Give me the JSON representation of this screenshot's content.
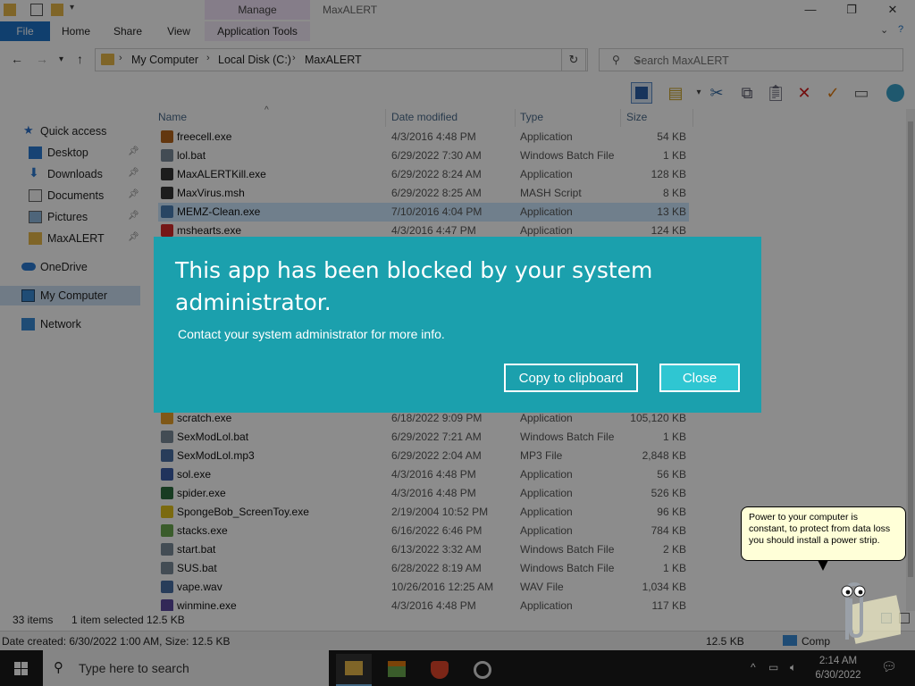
{
  "window": {
    "title": "MaxALERT",
    "contextual_tab": "Manage",
    "controls": {
      "minimize": "—",
      "maximize": "❐",
      "close": "✕"
    }
  },
  "ribbon": {
    "tabs": [
      "File",
      "Home",
      "Share",
      "View",
      "Application Tools"
    ],
    "expand_icon": "⌄",
    "help_icon": "?"
  },
  "address": {
    "crumbs": [
      "My Computer",
      "Local Disk (C:)",
      "MaxALERT"
    ],
    "search_placeholder": "Search MaxALERT"
  },
  "nav_pane": {
    "items": [
      {
        "label": "Quick access",
        "icon": "star-icon",
        "pinned": false
      },
      {
        "label": "Desktop",
        "icon": "desktop-icon",
        "pinned": true
      },
      {
        "label": "Downloads",
        "icon": "download-icon",
        "pinned": true
      },
      {
        "label": "Documents",
        "icon": "documents-icon",
        "pinned": true
      },
      {
        "label": "Pictures",
        "icon": "pictures-icon",
        "pinned": true
      },
      {
        "label": "MaxALERT",
        "icon": "folder-icon",
        "pinned": true
      },
      {
        "label": "OneDrive",
        "icon": "cloud-icon",
        "pinned": false
      },
      {
        "label": "My Computer",
        "icon": "computer-icon",
        "pinned": false,
        "selected": true
      },
      {
        "label": "Network",
        "icon": "network-icon",
        "pinned": false
      }
    ]
  },
  "columns": [
    "Name",
    "Date modified",
    "Type",
    "Size"
  ],
  "files": [
    {
      "name": "freecell.exe",
      "date": "4/3/2016 4:48 PM",
      "type": "Application",
      "size": "54 KB",
      "color": "#b5651d"
    },
    {
      "name": "lol.bat",
      "date": "6/29/2022 7:30 AM",
      "type": "Windows Batch File",
      "size": "1 KB",
      "color": "#7a8a99"
    },
    {
      "name": "MaxALERTKill.exe",
      "date": "6/29/2022 8:24 AM",
      "type": "Application",
      "size": "128 KB",
      "color": "#333333"
    },
    {
      "name": "MaxVirus.msh",
      "date": "6/29/2022 8:25 AM",
      "type": "MASH Script",
      "size": "8 KB",
      "color": "#333333"
    },
    {
      "name": "MEMZ-Clean.exe",
      "date": "7/10/2016 4:04 PM",
      "type": "Application",
      "size": "13 KB",
      "color": "#4a7fb5",
      "selected": true
    },
    {
      "name": "mshearts.exe",
      "date": "4/3/2016 4:47 PM",
      "type": "Application",
      "size": "124 KB",
      "color": "#d62b2b"
    },
    {
      "name": "scratch.exe",
      "date": "6/18/2022 9:09 PM",
      "type": "Application",
      "size": "105,120 KB",
      "color": "#e7a12b"
    },
    {
      "name": "SexModLol.bat",
      "date": "6/29/2022 7:21 AM",
      "type": "Windows Batch File",
      "size": "1 KB",
      "color": "#7a8a99"
    },
    {
      "name": "SexModLol.mp3",
      "date": "6/29/2022 2:04 AM",
      "type": "MP3 File",
      "size": "2,848 KB",
      "color": "#4a6fa5"
    },
    {
      "name": "sol.exe",
      "date": "4/3/2016 4:48 PM",
      "type": "Application",
      "size": "56 KB",
      "color": "#3b5ea8"
    },
    {
      "name": "spider.exe",
      "date": "4/3/2016 4:48 PM",
      "type": "Application",
      "size": "526 KB",
      "color": "#2d6d3e"
    },
    {
      "name": "SpongeBob_ScreenToy.exe",
      "date": "2/19/2004 10:52 PM",
      "type": "Application",
      "size": "96 KB",
      "color": "#e0c21c"
    },
    {
      "name": "stacks.exe",
      "date": "6/16/2022 6:46 PM",
      "type": "Application",
      "size": "784 KB",
      "color": "#6aa84f"
    },
    {
      "name": "start.bat",
      "date": "6/13/2022 3:32 AM",
      "type": "Windows Batch File",
      "size": "2 KB",
      "color": "#7a8a99"
    },
    {
      "name": "SUS.bat",
      "date": "6/28/2022 8:19 AM",
      "type": "Windows Batch File",
      "size": "1 KB",
      "color": "#7a8a99"
    },
    {
      "name": "vape.wav",
      "date": "10/26/2016 12:25 AM",
      "type": "WAV File",
      "size": "1,034 KB",
      "color": "#4a6fa5"
    },
    {
      "name": "winmine.exe",
      "date": "4/3/2016 4:48 PM",
      "type": "Application",
      "size": "117 KB",
      "color": "#5c4a9e"
    }
  ],
  "status": {
    "items": "33 items",
    "selection": "1 item selected  12.5 KB"
  },
  "details": {
    "info": "Date created: 6/30/2022 1:00 AM, Size: 12.5 KB",
    "size": "12.5 KB",
    "location": "Comp"
  },
  "dialog": {
    "title": "This app has been blocked by your system administrator.",
    "message": "Contact your system administrator for more info.",
    "copy_label": "Copy to clipboard",
    "close_label": "Close",
    "color": "#1ba0ad"
  },
  "clippy": {
    "tip": "Power to your computer is constant, to protect from data loss you should install a power strip."
  },
  "taskbar": {
    "search_placeholder": "Type here to search",
    "apps": [
      "file-explorer-icon",
      "bluestacks-icon",
      "brave-icon",
      "app-ring-icon"
    ],
    "time": "2:14 AM",
    "date": "6/30/2022"
  }
}
